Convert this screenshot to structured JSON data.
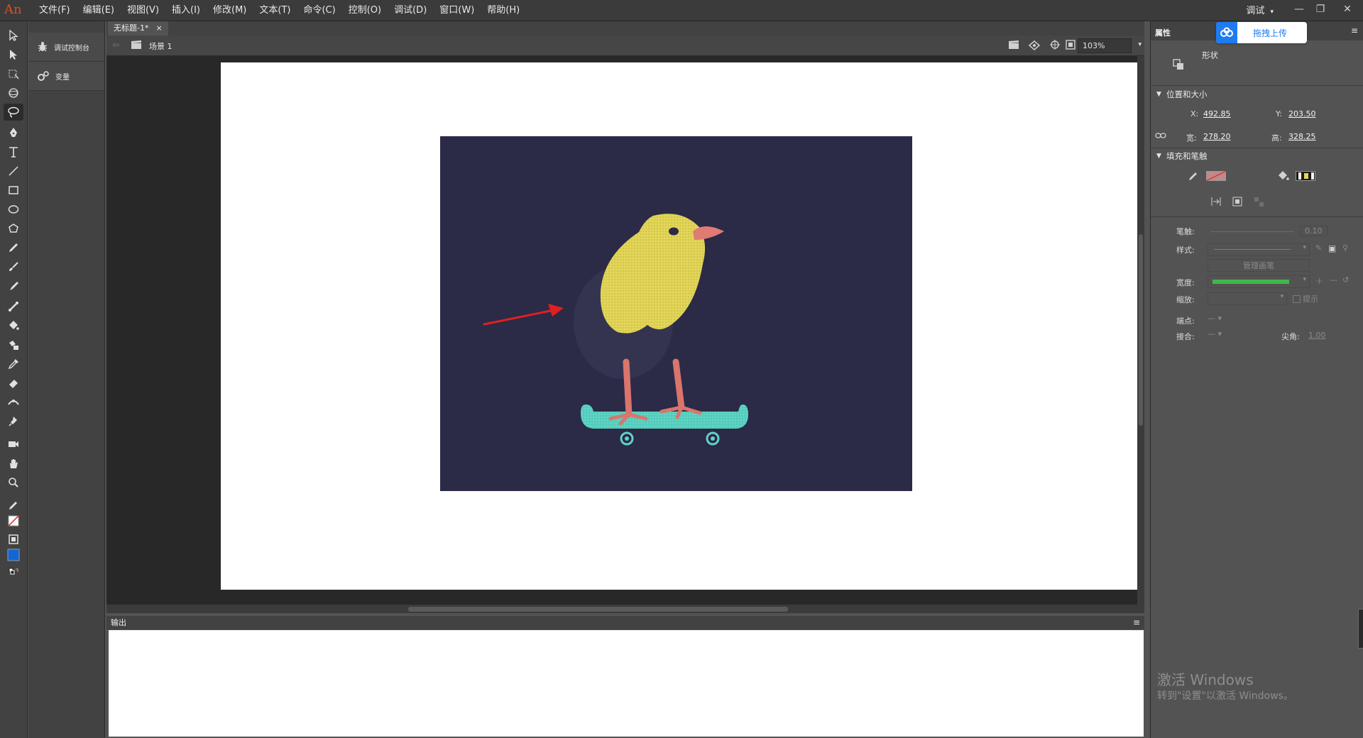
{
  "app": {
    "logo": "An"
  },
  "menu": [
    "文件(F)",
    "编辑(E)",
    "视图(V)",
    "插入(I)",
    "修改(M)",
    "文本(T)",
    "命令(C)",
    "控制(O)",
    "调试(D)",
    "窗口(W)",
    "帮助(H)"
  ],
  "window": {
    "workspace": "调试",
    "minimize": "—",
    "restore": "❐",
    "close": "✕"
  },
  "sidepanel": {
    "debug_console": "调试控制台",
    "variables": "变量"
  },
  "document": {
    "tab_title": "无标题-1*",
    "tab_close": "×",
    "scene": "场景 1",
    "zoom": "103%"
  },
  "output": {
    "tab": "输出"
  },
  "properties": {
    "tab": "属性",
    "upload_button": "拖拽上传",
    "object_type": "形状",
    "position_size": {
      "header": "位置和大小",
      "x_label": "X:",
      "x": "492.85",
      "y_label": "Y:",
      "y": "203.50",
      "w_label": "宽:",
      "w": "278.20",
      "h_label": "高:",
      "h": "328.25"
    },
    "fill_stroke": {
      "header": "填充和笔触",
      "stroke_label": "笔触:",
      "stroke_value": "0.10",
      "style_label": "样式:",
      "manage_brush": "管理画笔",
      "width_label": "宽度:",
      "scale_label": "缩放:",
      "hint_label": "提示",
      "cap_label": "端点:",
      "join_label": "接合:",
      "miter_label": "尖角:",
      "miter_value": "1.00"
    }
  },
  "watermark": {
    "title": "激活 Windows",
    "subtitle": "转到\"设置\"以激活 Windows。"
  },
  "colors": {
    "stage_bg": "#2b2a47",
    "chick_body": "#e3d65a",
    "beak": "#e07b73",
    "legs": "#d9756c",
    "skateboard": "#5fd4c4",
    "arrow": "#e02020",
    "accent_blue": "#1e7bf2"
  }
}
